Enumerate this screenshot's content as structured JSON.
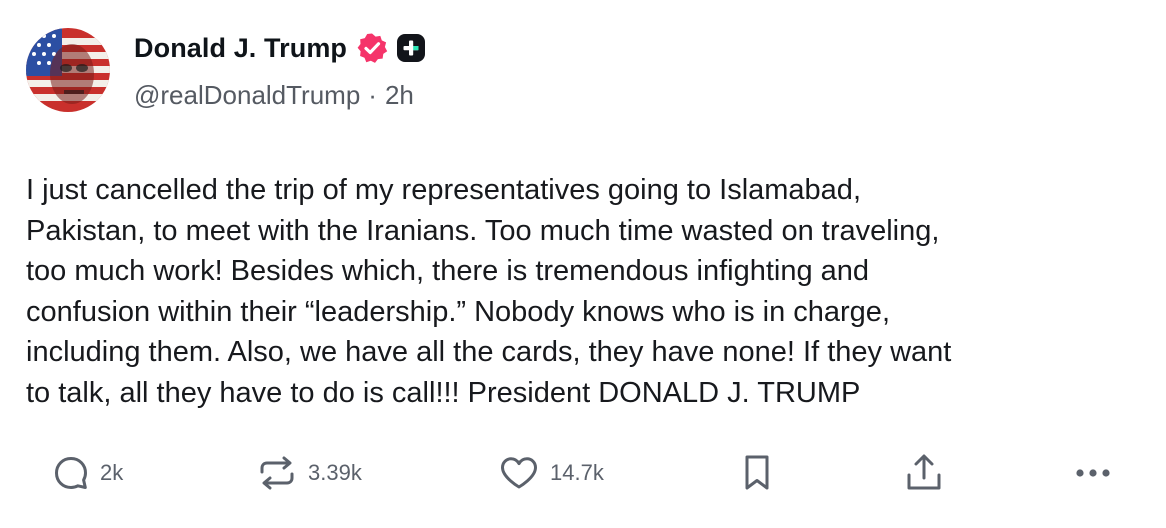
{
  "author": {
    "display_name": "Donald J. Trump",
    "handle": "@realDonaldTrump",
    "separator": "·",
    "time_ago": "2h",
    "verified_color": "#f5346a"
  },
  "post": {
    "text": "I just cancelled the trip of my representatives going to Islamabad,\nPakistan, to meet with the Iranians. Too much time wasted on traveling,\ntoo much work! Besides which, there is tremendous infighting and\nconfusion within their “leadership.” Nobody knows who is in charge,\nincluding them. Also, we have all the cards, they have none! If they want\nto talk, all they have to do is call!!! President DONALD J. TRUMP"
  },
  "actions": {
    "reply": {
      "icon": "reply-icon",
      "count": "2k"
    },
    "retruth": {
      "icon": "retruth-icon",
      "count": "3.39k"
    },
    "like": {
      "icon": "heart-icon",
      "count": "14.7k"
    },
    "bookmark": {
      "icon": "bookmark-icon"
    },
    "share": {
      "icon": "share-icon"
    },
    "more": {
      "icon": "more-icon"
    }
  }
}
